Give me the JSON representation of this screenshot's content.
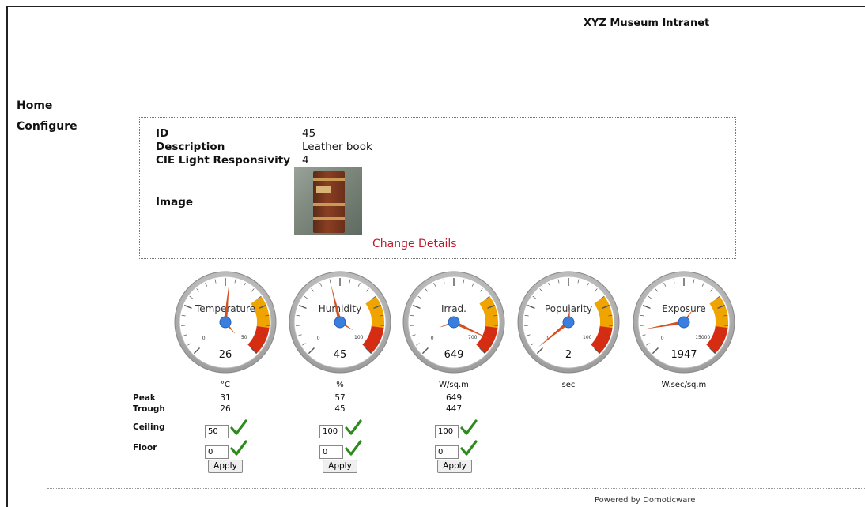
{
  "header": {
    "title": "XYZ Museum Intranet"
  },
  "nav": {
    "items": [
      "Home",
      "Configure"
    ]
  },
  "details": {
    "id_label": "ID",
    "id_value": "45",
    "description_label": "Description",
    "description_value": "Leather book",
    "cie_label": "CIE Light Responsivity",
    "cie_value": "4",
    "image_label": "Image",
    "change_link": "Change Details"
  },
  "gauges": [
    {
      "label": "Temperature",
      "value": "26",
      "min": "0",
      "max": "50",
      "unit": "°C",
      "accent": "#e8a300"
    },
    {
      "label": "Humidity",
      "value": "45",
      "min": "0",
      "max": "100",
      "unit": "%",
      "accent": "#e8a300"
    },
    {
      "label": "Irrad.",
      "value": "649",
      "min": "0",
      "max": "700",
      "unit": "W/sq.m",
      "accent": "#e8a300"
    },
    {
      "label": "Popularity",
      "value": "2",
      "min": "0",
      "max": "100",
      "unit": "sec",
      "accent": "#e8a300"
    },
    {
      "label": "Exposure",
      "value": "1947",
      "min": "0",
      "max": "15000",
      "unit": "W.sec/sq.m",
      "accent": "#e8a300"
    }
  ],
  "gauge_levels": [
    0.52,
    0.45,
    0.927,
    0.02,
    0.13
  ],
  "stats": {
    "peak_label": "Peak",
    "trough_label": "Trough",
    "ceiling_label": "Ceiling",
    "floor_label": "Floor",
    "peaks": [
      "31",
      "57",
      "649"
    ],
    "troughs": [
      "26",
      "45",
      "447"
    ],
    "ceilings": [
      "50",
      "100",
      "100"
    ],
    "floors": [
      "0",
      "0",
      "0"
    ],
    "apply_label": "Apply"
  },
  "footer": {
    "powered": "Powered by Domoticware"
  },
  "colors": {
    "link": "#c0182a",
    "needle": "#d5501e",
    "hub": "#3a7fe0",
    "red_zone": "#d62d12",
    "amber_zone": "#f0a400",
    "check": "#2e8b1e"
  }
}
